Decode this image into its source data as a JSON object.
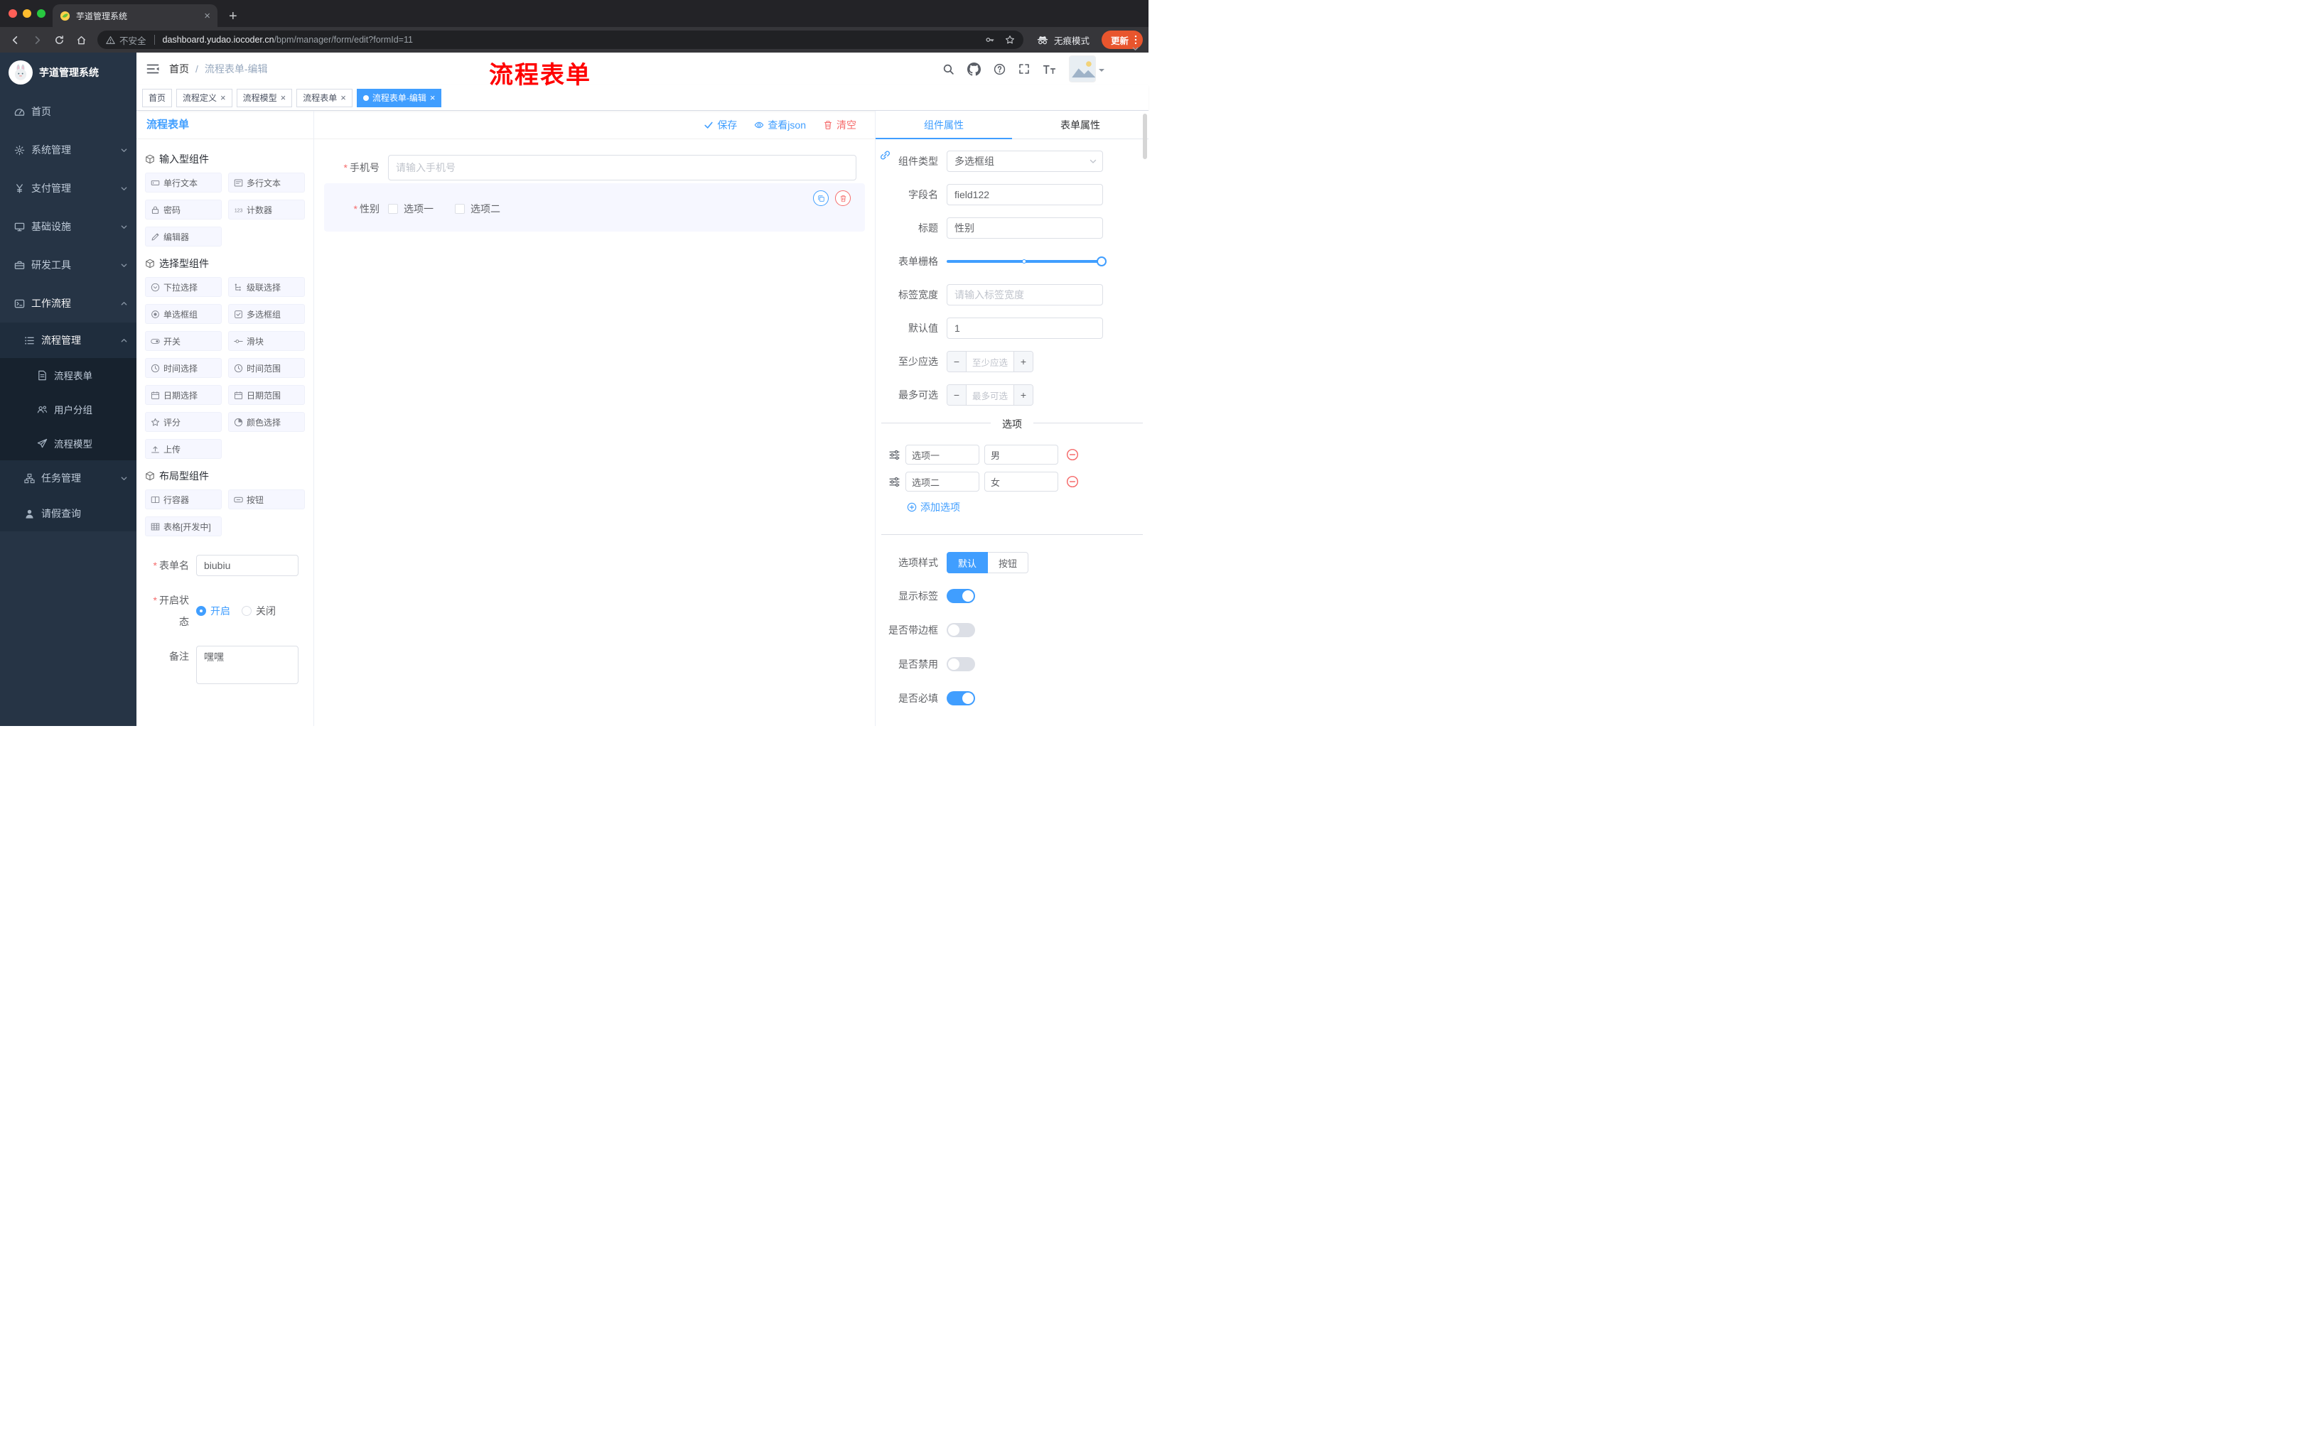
{
  "browser": {
    "tab_title": "芋道管理系统",
    "security_label": "不安全",
    "url_domain": "dashboard.yudao.iocoder.cn",
    "url_path": "/bpm/manager/form/edit?formId=11",
    "incognito_label": "无痕模式",
    "update_label": "更新"
  },
  "annotation": {
    "text": "流程表单"
  },
  "sidebar": {
    "logo_title": "芋道管理系统",
    "menu": [
      {
        "label": "首页"
      },
      {
        "label": "系统管理"
      },
      {
        "label": "支付管理"
      },
      {
        "label": "基础设施"
      },
      {
        "label": "研发工具"
      },
      {
        "label": "工作流程"
      },
      {
        "label": "流程管理"
      },
      {
        "label": "流程表单"
      },
      {
        "label": "用户分组"
      },
      {
        "label": "流程模型"
      },
      {
        "label": "任务管理"
      },
      {
        "label": "请假查询"
      }
    ]
  },
  "header": {
    "breadcrumb": [
      "首页",
      "流程表单-编辑"
    ]
  },
  "tags": [
    {
      "label": "首页"
    },
    {
      "label": "流程定义"
    },
    {
      "label": "流程模型"
    },
    {
      "label": "流程表单"
    },
    {
      "label": "流程表单-编辑"
    }
  ],
  "palette": {
    "panel_title": "流程表单",
    "sections": [
      {
        "title": "输入型组件",
        "items": [
          {
            "label": "单行文本"
          },
          {
            "label": "多行文本"
          },
          {
            "label": "密码"
          },
          {
            "label": "计数器"
          },
          {
            "label": "编辑器"
          }
        ]
      },
      {
        "title": "选择型组件",
        "items": [
          {
            "label": "下拉选择"
          },
          {
            "label": "级联选择"
          },
          {
            "label": "单选框组"
          },
          {
            "label": "多选框组"
          },
          {
            "label": "开关"
          },
          {
            "label": "滑块"
          },
          {
            "label": "时间选择"
          },
          {
            "label": "时间范围"
          },
          {
            "label": "日期选择"
          },
          {
            "label": "日期范围"
          },
          {
            "label": "评分"
          },
          {
            "label": "颜色选择"
          },
          {
            "label": "上传"
          }
        ]
      },
      {
        "title": "布局型组件",
        "items": [
          {
            "label": "行容器"
          },
          {
            "label": "按钮"
          },
          {
            "label": "表格[开发中]"
          }
        ]
      }
    ],
    "form": {
      "name_label": "表单名",
      "name_value": "biubiu",
      "status_label": "开启状态",
      "status_options": [
        "开启",
        "关闭"
      ],
      "remark_label": "备注",
      "remark_value": "嘿嘿"
    }
  },
  "toolbar": {
    "save": "保存",
    "view_json": "查看json",
    "clear": "清空"
  },
  "canvas": {
    "phone_label": "手机号",
    "phone_placeholder": "请输入手机号",
    "gender_label": "性别",
    "gender_options": [
      "选项一",
      "选项二"
    ]
  },
  "props": {
    "tabs": [
      "组件属性",
      "表单属性"
    ],
    "rows": {
      "type_label": "组件类型",
      "type_value": "多选框组",
      "field_label": "字段名",
      "field_value": "field122",
      "title_label": "标题",
      "title_value": "性别",
      "grid_label": "表单栅格",
      "width_label": "标签宽度",
      "width_placeholder": "请输入标签宽度",
      "default_label": "默认值",
      "default_value": "1",
      "min_label": "至少应选",
      "min_placeholder": "至少应选",
      "max_label": "最多可选",
      "max_placeholder": "最多可选"
    },
    "options": {
      "divider": "选项",
      "items": [
        {
          "name": "选项一",
          "value": "男"
        },
        {
          "name": "选项二",
          "value": "女"
        }
      ],
      "add_label": "添加选项"
    },
    "style": {
      "label": "选项样式",
      "options": [
        "默认",
        "按钮"
      ]
    },
    "switches": [
      {
        "label": "显示标签"
      },
      {
        "label": "是否带边框"
      },
      {
        "label": "是否禁用"
      },
      {
        "label": "是否必填"
      }
    ]
  },
  "colors": {
    "accent": "#409eff",
    "danger": "#f56c6c",
    "annotation": "#ff0000",
    "sidebar": "#263445"
  }
}
